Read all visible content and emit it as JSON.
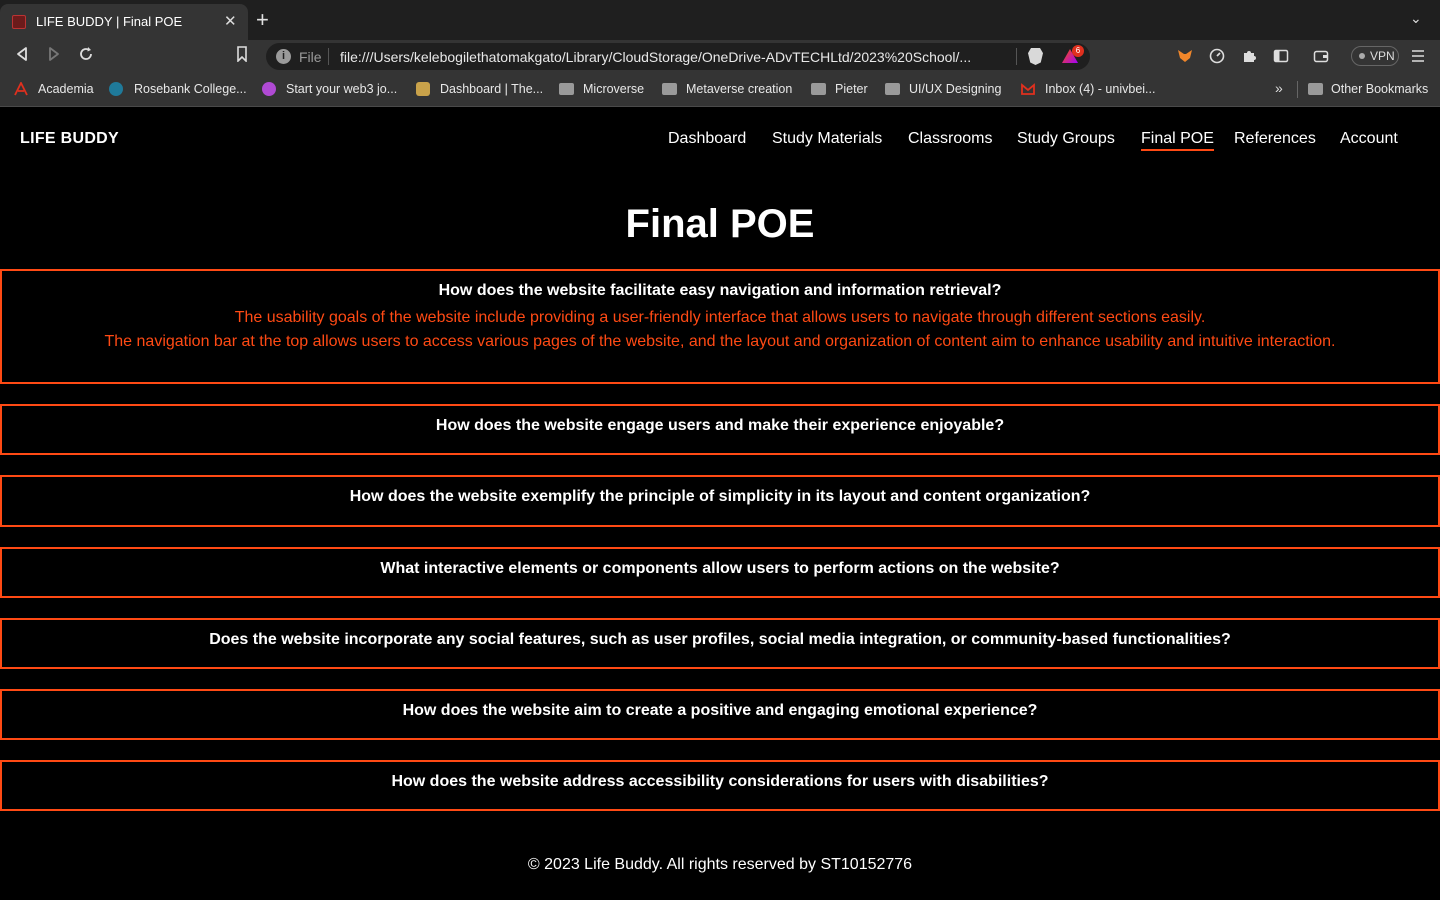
{
  "browser": {
    "tab_title": "LIFE BUDDY | Final POE",
    "close_glyph": "✕",
    "new_tab_glyph": "+",
    "tab_list_glyph": "⌄",
    "address_scheme": "File",
    "address_url": "file:///Users/kelebogilethatomakgato/Library/CloudStorage/OneDrive-ADvTECHLtd/2023%20School/...",
    "rewards_badge": "6",
    "vpn_label": "VPN",
    "bookmarks": [
      "Academia",
      "Rosebank College...",
      "Start your web3 jo...",
      "Dashboard | The...",
      "Microverse",
      "Metaverse creation",
      "Pieter",
      "UI/UX Designing",
      "Inbox (4) - univbei..."
    ],
    "bookmarks_more": "»",
    "other_bookmarks": "Other Bookmarks",
    "accent_color": "#ff4a14"
  },
  "site": {
    "logo": "LIFE BUDDY",
    "nav": [
      "Dashboard",
      "Study Materials",
      "Classrooms",
      "Study Groups",
      "Final POE",
      "References",
      "Account"
    ],
    "active_nav": "Final POE"
  },
  "main": {
    "title": "Final POE",
    "faqs": [
      {
        "question": "How does the website facilitate easy navigation and information retrieval?",
        "answer": [
          "The usability goals of the website include providing a user-friendly interface that allows users to navigate through different sections easily.",
          "The navigation bar at the top allows users to access various pages of the website, and the layout and organization of content aim to enhance usability and intuitive interaction."
        ]
      },
      {
        "question": "How does the website engage users and make their experience enjoyable?"
      },
      {
        "question": "How does the website exemplify the principle of simplicity in its layout and content organization?"
      },
      {
        "question": "What interactive elements or components allow users to perform actions on the website?"
      },
      {
        "question": "Does the website incorporate any social features, such as user profiles, social media integration, or community-based functionalities?"
      },
      {
        "question": "How does the website aim to create a positive and engaging emotional experience?"
      },
      {
        "question": "How does the website address accessibility considerations for users with disabilities?"
      }
    ]
  },
  "footer": {
    "text": "© 2023 Life Buddy. All rights reserved by ST10152776"
  }
}
